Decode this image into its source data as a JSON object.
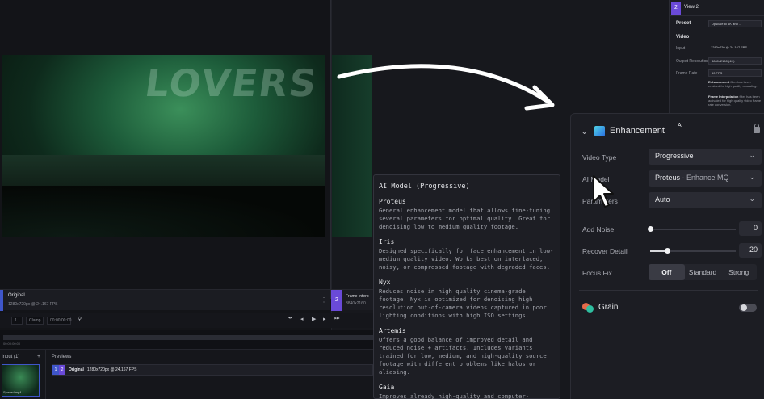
{
  "left_clip": {
    "title": "Original",
    "meta": "1280x720px @ 24.167 FPS"
  },
  "mid_clip": {
    "number": "2",
    "title": "Frame Interp",
    "meta": "3840x2160"
  },
  "transport": {
    "frame": "1",
    "field2": "Clamp",
    "timecode": "00:00:00:00",
    "ruler_label": "00:00:00:00"
  },
  "bottom": {
    "input_header": "Input (1)",
    "add": "+",
    "previews_header": "Previews",
    "thumb_label": "Spaced.mp4",
    "preview_row": {
      "n1": "1",
      "n2": "2",
      "title": "Original",
      "meta": "1280x720px @ 24.167 FPS"
    }
  },
  "view2": {
    "number": "2",
    "title": "View 2",
    "preset_label": "Preset",
    "preset_value": "Upscale to 4K and ...",
    "video_label": "Video",
    "input_label": "Input",
    "input_value": "1280x720 @ 24.167 FPS",
    "output_label": "Output Resolution",
    "output_value": "3840x2160 (4K)",
    "frame_rate_label": "Frame Rate",
    "frame_rate_value": "60 FPS",
    "note1_bold": "Enhancement",
    "note1_rest": " filter has been enabled for high quality upscaling.",
    "note2_bold": "Frame Interpolation",
    "note2_rest": " filter has been activated for high quality video frame rate conversion."
  },
  "tooltip": {
    "title": "AI Model (Progressive)",
    "models": [
      {
        "name": "Proteus",
        "desc": "General enhancement model that allows fine-tuning several parameters for optimal quality. Great for denoising low to medium quality footage."
      },
      {
        "name": "Iris",
        "desc": "Designed specifically for face enhancement in low-medium quality video. Works best on interlaced, noisy, or compressed footage with degraded faces."
      },
      {
        "name": "Nyx",
        "desc": "Reduces noise in high quality cinema-grade footage. Nyx is optimized for denoising high resolution out-of-camera videos captured in poor lighting conditions with high ISO settings."
      },
      {
        "name": "Artemis",
        "desc": "Offers a good balance of improved detail and reduced noise + artifacts. Includes variants trained for low, medium, and high-quality source footage with different problems like halos or aliasing."
      },
      {
        "name": "Gaia",
        "desc": "Improves already high-quality and computer-generated input videos."
      }
    ]
  },
  "enhancement": {
    "title": "Enhancement",
    "ai_badge": "AI",
    "video_type_label": "Video Type",
    "video_type_value": "Progressive",
    "ai_model_label": "AI Model",
    "ai_model_value": "Proteus",
    "ai_model_sub": " - Enhance MQ",
    "parameters_label": "Parameters",
    "parameters_value": "Auto",
    "add_noise_label": "Add Noise",
    "add_noise_value": "0",
    "add_noise_fraction": 0,
    "recover_detail_label": "Recover Detail",
    "recover_detail_value": "20",
    "recover_detail_fraction": 0.2,
    "focus_fix_label": "Focus Fix",
    "focus_fix_options": [
      "Off",
      "Standard",
      "Strong"
    ],
    "focus_fix_selected": "Off",
    "grain_title": "Grain",
    "grain_enabled": false
  },
  "video_banner": "LOVERS",
  "colors": {
    "accent_blue": "#3f56c9",
    "accent_purple": "#6a4ad8",
    "panel_bg": "#1c1d23"
  },
  "icons": [
    "chevron-down-icon",
    "enhancement-icon",
    "lock-icon",
    "grain-icon",
    "caret-down-icon",
    "play-icon",
    "skip-back-icon",
    "skip-forward-icon",
    "more-icon"
  ]
}
